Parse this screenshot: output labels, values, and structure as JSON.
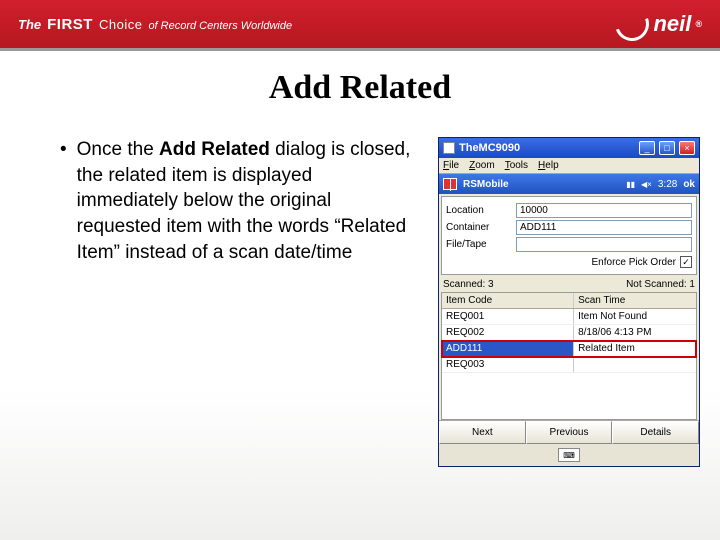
{
  "header": {
    "the": "The",
    "first": "FIRST",
    "choice": "Choice",
    "tagline": "of Record Centers Worldwide",
    "logo_text": "neil"
  },
  "slide": {
    "title": "Add Related",
    "bullet_prefix": "Once the ",
    "bullet_bold": "Add Related",
    "bullet_rest": " dialog is closed, the related item is displayed immediately below the original requested item with the words “Related Item” instead of a scan date/time"
  },
  "window": {
    "title": "TheMC9090",
    "menu": [
      "File",
      "Zoom",
      "Tools",
      "Help"
    ],
    "app": "RSMobile",
    "clock": "3:28",
    "ok": "ok",
    "form": {
      "location_label": "Location",
      "location_value": "10000",
      "container_label": "Container",
      "container_value": "ADD111",
      "filetape_label": "File/Tape",
      "filetape_value": "",
      "enforce_label": "Enforce Pick Order",
      "enforce_checked": "✓"
    },
    "scan": {
      "scanned": "Scanned: 3",
      "notscanned": "Not Scanned: 1"
    },
    "grid": {
      "h1": "Item Code",
      "h2": "Scan Time",
      "rows": [
        {
          "code": "REQ001",
          "time": "Item Not Found"
        },
        {
          "code": "REQ002",
          "time": "8/18/06 4:13 PM"
        },
        {
          "code": "ADD111",
          "time": "Related Item"
        },
        {
          "code": "REQ003",
          "time": ""
        }
      ],
      "highlight_index": 2
    },
    "buttons": {
      "next": "Next",
      "prev": "Previous",
      "details": "Details"
    }
  }
}
